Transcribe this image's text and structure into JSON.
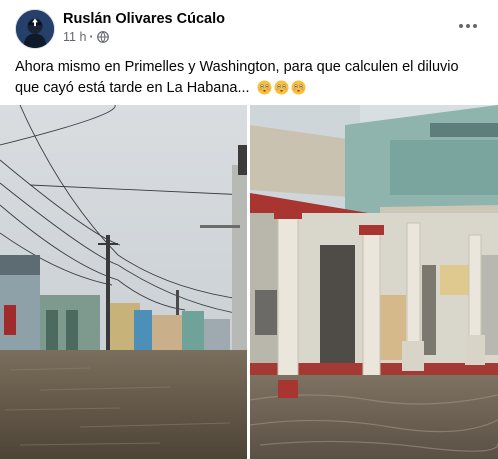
{
  "post": {
    "author": "Ruslán Olivares Cúcalo",
    "time": "11 h",
    "separator": "·",
    "privacy_icon": "globe-icon",
    "more_icon": "more-options-icon",
    "text": "Ahora mismo en Primelles y Washington, para que calculen el diluvio que cayó está tarde en La Habana...",
    "emoji_icon": "flushed-face-emoji",
    "emoji_count": 3
  },
  "photos": [
    {
      "name": "flooded-street-photo",
      "scene": "flooded street with power lines"
    },
    {
      "name": "flooded-colonnade-photo",
      "scene": "flooded colonnade building"
    }
  ],
  "colors": {
    "text_primary": "#050505",
    "text_secondary": "#65676b",
    "water": "#6b5e4c",
    "sky": "#c9cfd4"
  }
}
